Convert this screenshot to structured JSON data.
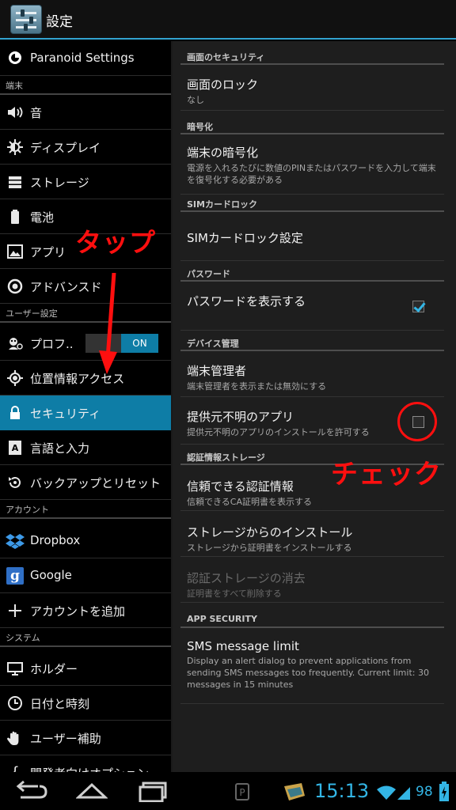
{
  "app": {
    "title": "設定"
  },
  "sidebar": {
    "paranoid": "Paranoid Settings",
    "headers": {
      "device": "端末",
      "user": "ユーザー設定",
      "account": "アカウント",
      "system": "システム"
    },
    "items": [
      {
        "label": "音",
        "icon": "volume-icon"
      },
      {
        "label": "ディスプレイ",
        "icon": "brightness-icon"
      },
      {
        "label": "ストレージ",
        "icon": "storage-icon"
      },
      {
        "label": "電池",
        "icon": "battery-icon"
      },
      {
        "label": "アプリ",
        "icon": "apps-icon"
      },
      {
        "label": "アドバンスド",
        "icon": "advanced-icon"
      },
      {
        "label": "プロフ..",
        "icon": "profile-icon",
        "toggle": "ON"
      },
      {
        "label": "位置情報アクセス",
        "icon": "location-icon"
      },
      {
        "label": "セキュリティ",
        "icon": "lock-icon",
        "active": true
      },
      {
        "label": "言語と入力",
        "icon": "language-icon"
      },
      {
        "label": "バックアップとリセット",
        "icon": "backup-icon"
      },
      {
        "label": "Dropbox",
        "icon": "dropbox-icon"
      },
      {
        "label": "Google",
        "icon": "google-icon"
      },
      {
        "label": "アカウントを追加",
        "icon": "add-icon"
      },
      {
        "label": "ホルダー",
        "icon": "monitor-icon"
      },
      {
        "label": "日付と時刻",
        "icon": "clock-icon"
      },
      {
        "label": "ユーザー補助",
        "icon": "hand-icon"
      },
      {
        "label": "開発者向けオプション",
        "icon": "braces-icon"
      }
    ]
  },
  "security": {
    "cat_screen": "画面のセキュリティ",
    "screen_lock": {
      "title": "画面のロック",
      "summary": "なし"
    },
    "cat_encryption": "暗号化",
    "encrypt": {
      "title": "端末の暗号化",
      "summary": "電源を入れるたびに数値のPINまたはパスワードを入力して端末を復号化する必要がある"
    },
    "cat_sim": "SIMカードロック",
    "sim_lock": {
      "title": "SIMカードロック設定"
    },
    "cat_password": "パスワード",
    "show_password": {
      "title": "パスワードを表示する",
      "checked": true
    },
    "cat_device_admin": "デバイス管理",
    "device_admin": {
      "title": "端末管理者",
      "summary": "端末管理者を表示または無効にする"
    },
    "unknown_sources": {
      "title": "提供元不明のアプリ",
      "summary": "提供元不明のアプリのインストールを許可する",
      "checked": false
    },
    "cat_credentials": "認証情報ストレージ",
    "trusted_creds": {
      "title": "信頼できる認証情報",
      "summary": "信頼できるCA証明書を表示する"
    },
    "install_storage": {
      "title": "ストレージからのインストール",
      "summary": "ストレージから証明書をインストールする"
    },
    "clear_creds": {
      "title": "認証ストレージの消去",
      "summary": "証明書をすべて削除する",
      "disabled": true
    },
    "cat_app_security": "APP SECURITY",
    "sms_limit": {
      "title": "SMS message limit",
      "summary": "Display an alert dialog to prevent applications from sending SMS messages too frequently. Current limit: 30 messages in 15 minutes"
    }
  },
  "annotations": {
    "tap": "タップ",
    "check": "チェック",
    "color": "#ff0f0f"
  },
  "statusbar": {
    "time": "15:13",
    "battery": "98"
  },
  "colors": {
    "accent": "#33b5e5",
    "selected": "#0e7da6"
  }
}
